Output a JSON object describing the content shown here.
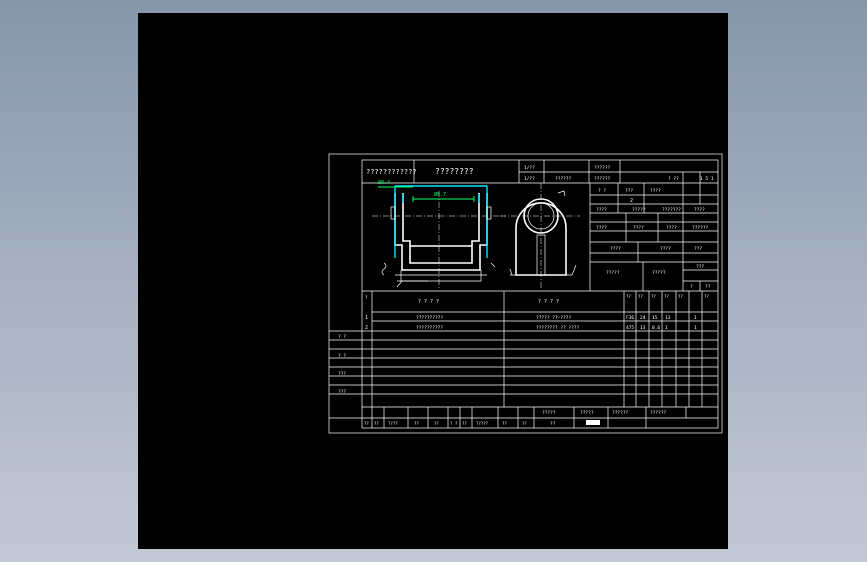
{
  "colors": {
    "viewport_background": "#000000",
    "desktop_gradient_top": "#8696aa",
    "desktop_gradient_bottom": "#c3c8d5",
    "line": "#ffffff",
    "cyan_feature": "#00e5ff",
    "green_dimension": "#00ff66"
  },
  "sheet": {
    "header": {
      "left_title": "????????????",
      "center_title": "????????",
      "cell_r1_a": "1/??",
      "cell_r1_b": "??????",
      "cell_r2_a": "1/??",
      "cell_r2_b": "??????",
      "cell_r2_c": "??????"
    },
    "dimensions": {
      "dim_top": "Ø0.4",
      "dim_inner": "Ø0.7"
    },
    "right_info": {
      "r1": [
        "? ??",
        "1 5 1"
      ],
      "r2": [
        "? ?",
        "???",
        "????"
      ],
      "r3": "2",
      "r4": [
        "????",
        "?????",
        "???????",
        "????"
      ],
      "r5": [
        "????",
        "????",
        "????",
        "??????"
      ],
      "r6": [
        "????",
        "????",
        "???"
      ],
      "r7": [
        "?????",
        "?????",
        "???"
      ],
      "r8": [
        "?",
        "??"
      ]
    },
    "process_header": {
      "col_no": "?\n?\n?",
      "col_name": "? ? ? ?",
      "col_equipment": "? ? ? ?",
      "col_params": [
        "??\n??",
        "??\n??\n??",
        "??\n??",
        "??\n??",
        "??\n??\n?",
        "??\n??"
      ]
    },
    "process_rows": [
      {
        "no": "1",
        "name": "??????????",
        "equipment": "????? ??-????",
        "params": [
          "F36",
          "24",
          "15",
          "13",
          "",
          "1"
        ]
      },
      {
        "no": "2",
        "name": "??????????",
        "equipment": "???????? ?? ????",
        "params": [
          "475",
          "13",
          "0.6",
          "1",
          "",
          "1"
        ]
      }
    ],
    "left_margin": [
      "? ?",
      "? ?",
      "???",
      "???"
    ],
    "footer": {
      "sign_cells": [
        "?????",
        "?????",
        "??????",
        "??????"
      ],
      "bottom_labels": [
        "??",
        "??",
        "????",
        "??",
        "??",
        "? ?",
        "??",
        "?????",
        "??",
        "??"
      ],
      "stamp": "??"
    }
  }
}
